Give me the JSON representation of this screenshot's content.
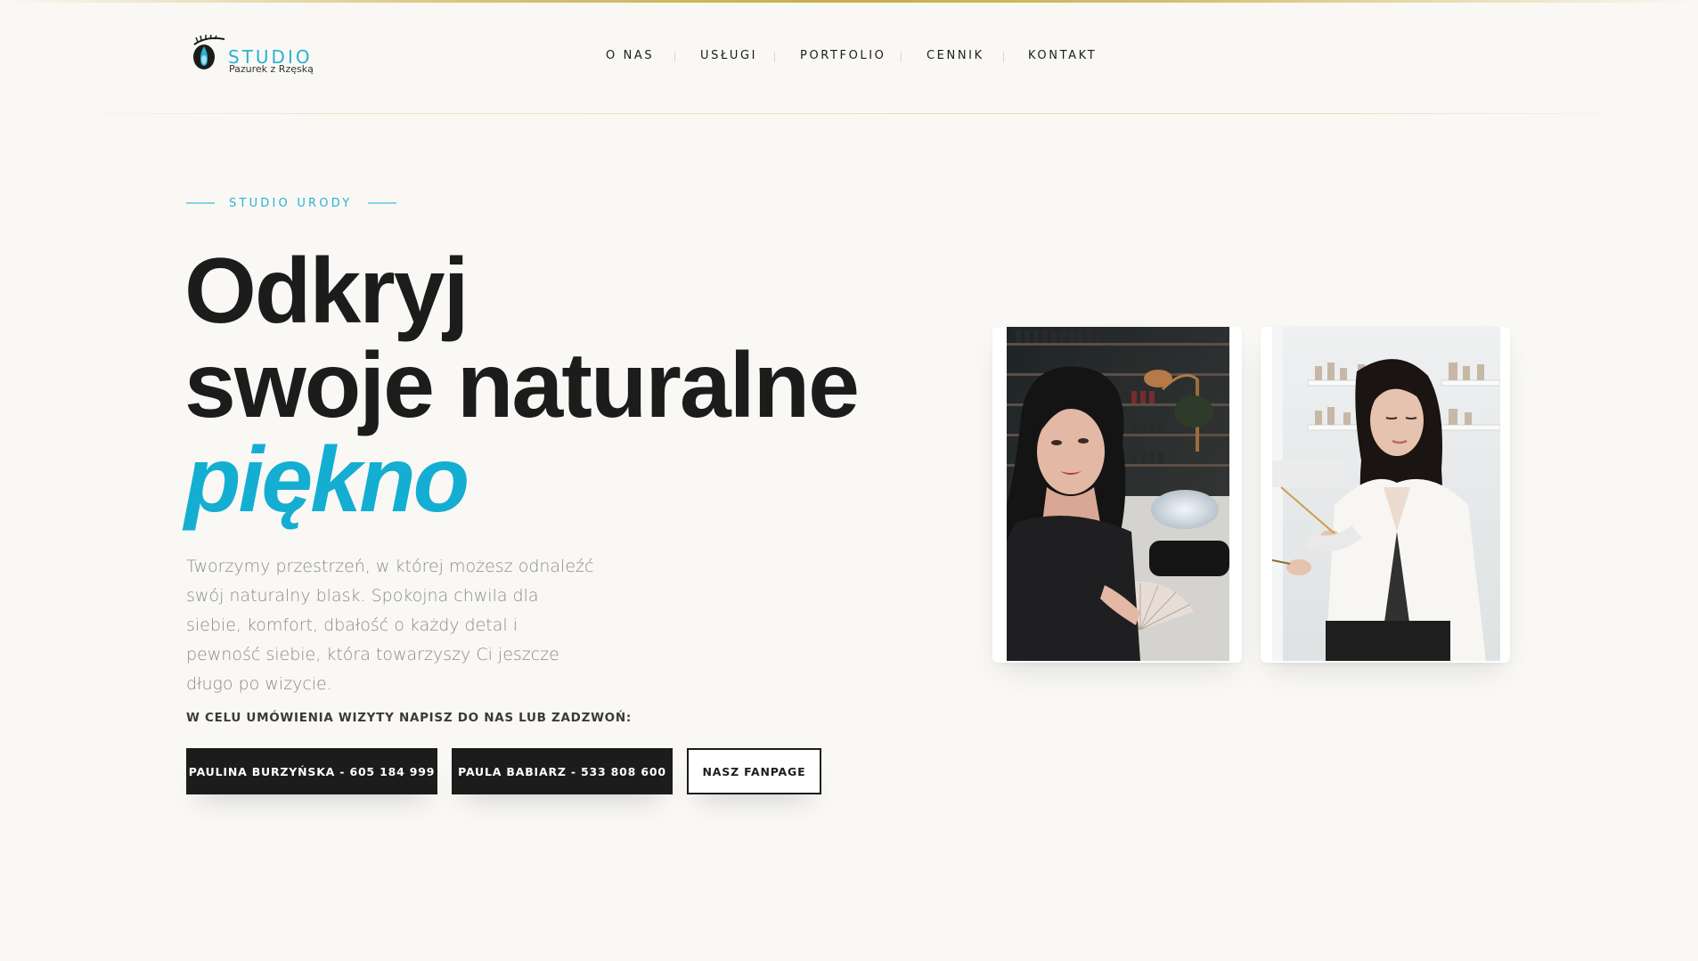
{
  "brand": {
    "logo_title": "STUDIO",
    "logo_subtitle": "Pazurek z Rzęską",
    "accent_color": "#14aed2",
    "dark_color": "#1c1c1c",
    "gold_color": "#d6c06e"
  },
  "nav": {
    "items": [
      {
        "label": "O NAS"
      },
      {
        "label": "USŁUGI"
      },
      {
        "label": "PORTFOLIO"
      },
      {
        "label": "CENNIK"
      },
      {
        "label": "KONTAKT"
      }
    ]
  },
  "hero": {
    "eyebrow": "STUDIO URODY",
    "headline_line1": "Odkryj",
    "headline_line2": "swoje naturalne",
    "headline_accent": "piękno",
    "lead": "Tworzymy przestrzeń, w której możesz odnaleźć swój naturalny blask. Spokojna chwila dla siebie, komfort, dbałość o każdy detal i pewność siebie, która towarzyszy Ci jeszcze długo po wizycie.",
    "cta_label": "W CELU UMÓWIENIA WIZYTY NAPISZ DO NAS LUB ZADZWOŃ:",
    "buttons": [
      {
        "label": "PAULINA BURZYŃSKA - 605 184 999",
        "style": "dark"
      },
      {
        "label": "PAULA BABIARZ - 533 808 600",
        "style": "dark"
      },
      {
        "label": "NASZ FANPAGE",
        "style": "outline"
      }
    ]
  },
  "photos": [
    {
      "subject": "photo-stylist-nail-station"
    },
    {
      "subject": "photo-stylist-lash-studio"
    }
  ]
}
